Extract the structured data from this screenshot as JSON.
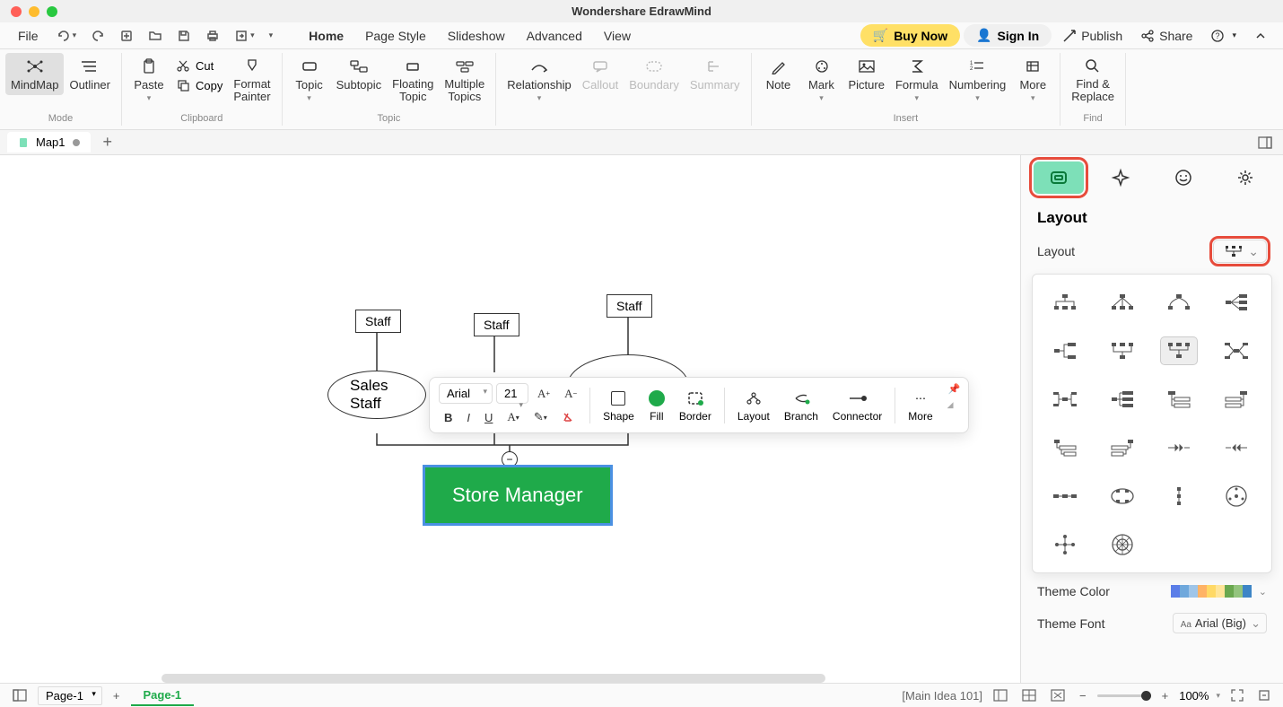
{
  "app_title": "Wondershare EdrawMind",
  "menu": {
    "file": "File",
    "home": "Home",
    "page_style": "Page Style",
    "slideshow": "Slideshow",
    "advanced": "Advanced",
    "view": "View",
    "buy_now": "Buy Now",
    "sign_in": "Sign In",
    "publish": "Publish",
    "share": "Share"
  },
  "ribbon": {
    "mindmap": "MindMap",
    "outliner": "Outliner",
    "mode_label": "Mode",
    "paste": "Paste",
    "cut": "Cut",
    "copy": "Copy",
    "format_painter": "Format\nPainter",
    "clipboard_label": "Clipboard",
    "topic": "Topic",
    "subtopic": "Subtopic",
    "floating_topic": "Floating\nTopic",
    "multiple_topics": "Multiple\nTopics",
    "topic_label": "Topic",
    "relationship": "Relationship",
    "callout": "Callout",
    "boundary": "Boundary",
    "summary": "Summary",
    "note": "Note",
    "mark": "Mark",
    "picture": "Picture",
    "formula": "Formula",
    "numbering": "Numbering",
    "more": "More",
    "insert_label": "Insert",
    "find_replace": "Find &\nReplace",
    "find_label": "Find"
  },
  "tabs": {
    "map1": "Map1"
  },
  "canvas": {
    "staff1": "Staff",
    "staff2": "Staff",
    "staff3": "Staff",
    "sales_staff": "Sales Staff",
    "store_manager": "Store Manager"
  },
  "floating_toolbar": {
    "font": "Arial",
    "size": "21",
    "shape": "Shape",
    "fill": "Fill",
    "border": "Border",
    "layout": "Layout",
    "branch": "Branch",
    "connector": "Connector",
    "more": "More"
  },
  "panel": {
    "section_title": "Layout",
    "layout_label": "Layout",
    "theme_color_label": "Theme Color",
    "theme_font_label": "Theme Font",
    "theme_font_value": "Arial (Big)",
    "theme_colors": [
      "#5b7ee8",
      "#6fa8dc",
      "#9fc5e8",
      "#ffb366",
      "#ffd966",
      "#ffe599",
      "#6aa84f",
      "#93c47d",
      "#3d85c6"
    ]
  },
  "status": {
    "page_selector": "Page-1",
    "page_tab": "Page-1",
    "main_idea": "[Main Idea 101]",
    "zoom": "100%"
  }
}
